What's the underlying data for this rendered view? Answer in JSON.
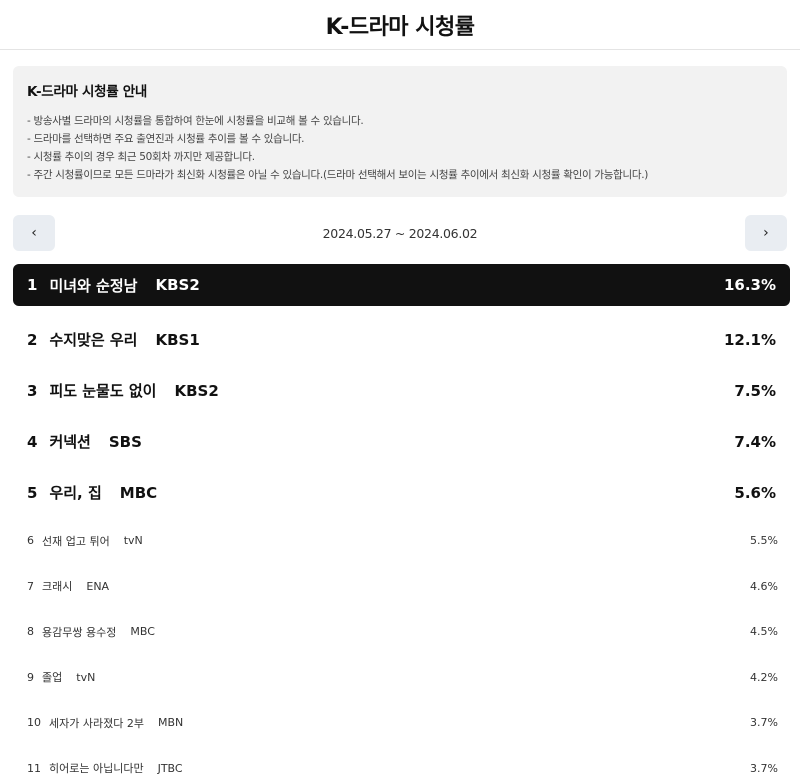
{
  "header": {
    "title": "K-드라마 시청률"
  },
  "notice": {
    "title": "K-드라마 시청률 안내",
    "lines": [
      "- 방송사별 드라마의 시청률을 통합하여 한눈에 시청률을 비교해 볼 수 있습니다.",
      "- 드라마를 선택하면 주요 출연진과 시청률 추이를 볼 수 있습니다.",
      "- 시청률 추이의 경우 최근 50회차 까지만 제공합니다.",
      "- 주간 시청률이므로 모든 드마라가 최신화 시청률은 아닐 수 있습니다.(드라마 선택해서 보이는 시청률 추이에서 최신화 시청률 확인이 가능합니다.)"
    ]
  },
  "week": {
    "range": "2024.05.27 ~ 2024.06.02",
    "prev_icon": "‹",
    "next_icon": "›"
  },
  "rankings": [
    {
      "rank": "1",
      "title": "미녀와 순정남",
      "network": "KBS2",
      "rating": "16.3%"
    },
    {
      "rank": "2",
      "title": "수지맞은 우리",
      "network": "KBS1",
      "rating": "12.1%"
    },
    {
      "rank": "3",
      "title": "피도 눈물도 없이",
      "network": "KBS2",
      "rating": "7.5%"
    },
    {
      "rank": "4",
      "title": "커넥션",
      "network": "SBS",
      "rating": "7.4%"
    },
    {
      "rank": "5",
      "title": "우리, 집",
      "network": "MBC",
      "rating": "5.6%"
    },
    {
      "rank": "6",
      "title": "선재 업고 튀어",
      "network": "tvN",
      "rating": "5.5%"
    },
    {
      "rank": "7",
      "title": "크래시",
      "network": "ENA",
      "rating": "4.6%"
    },
    {
      "rank": "8",
      "title": "용감무쌍 용수정",
      "network": "MBC",
      "rating": "4.5%"
    },
    {
      "rank": "9",
      "title": "졸업",
      "network": "tvN",
      "rating": "4.2%"
    },
    {
      "rank": "10",
      "title": "세자가 사라졌다 2부",
      "network": "MBN",
      "rating": "3.7%"
    },
    {
      "rank": "11",
      "title": "히어로는 아닙니다만",
      "network": "JTBC",
      "rating": "3.7%"
    }
  ]
}
